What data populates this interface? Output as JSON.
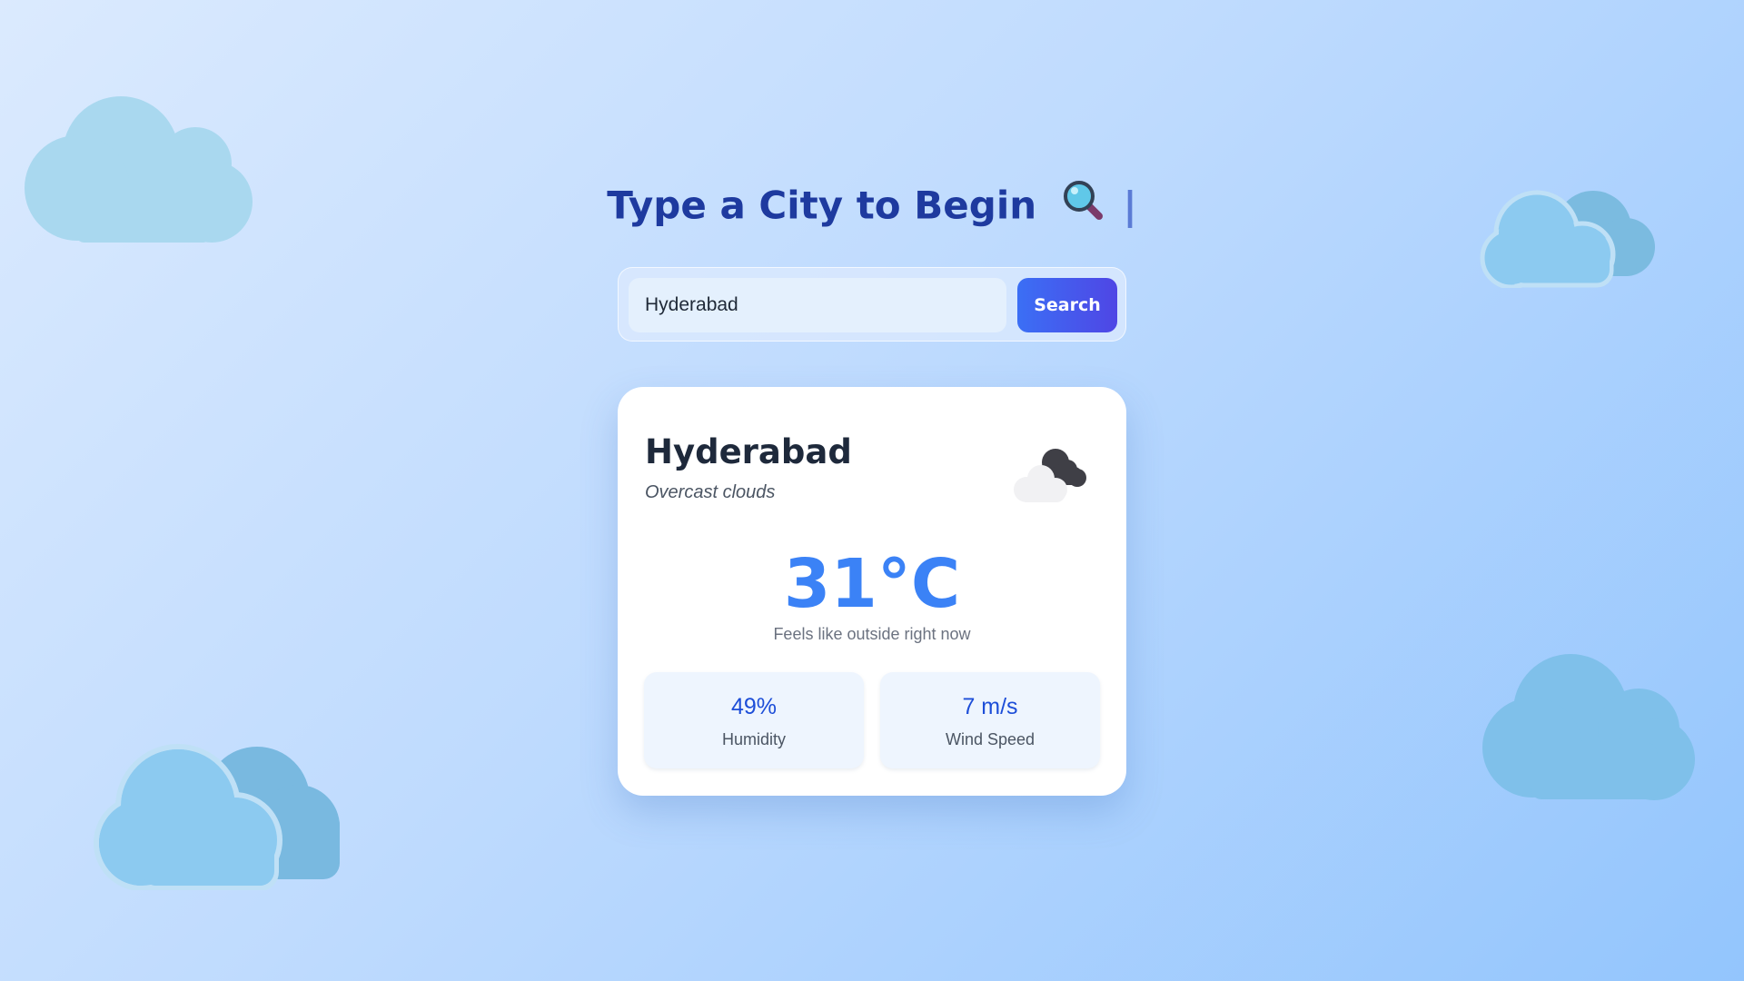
{
  "heading": {
    "text": "Type a City to Begin",
    "caret": "|",
    "icon": "magnifying-glass-icon"
  },
  "search": {
    "value": "Hyderabad",
    "placeholder": "",
    "button_label": "Search"
  },
  "weather": {
    "city": "Hyderabad",
    "condition": "Overcast clouds",
    "condition_icon": "overcast-clouds-icon",
    "temperature": "31°C",
    "feels_text": "Feels like outside right now",
    "stats": [
      {
        "value": "49%",
        "label": "Humidity"
      },
      {
        "value": "7 m/s",
        "label": "Wind Speed"
      }
    ]
  },
  "colors": {
    "accent": "#3b82f6",
    "heading": "#1e3a9f",
    "button_start": "#3b6ff5",
    "button_end": "#4f46e5",
    "background_start": "#dbeafe",
    "background_end": "#93c5fd",
    "cloud": "#7ec3ea"
  }
}
